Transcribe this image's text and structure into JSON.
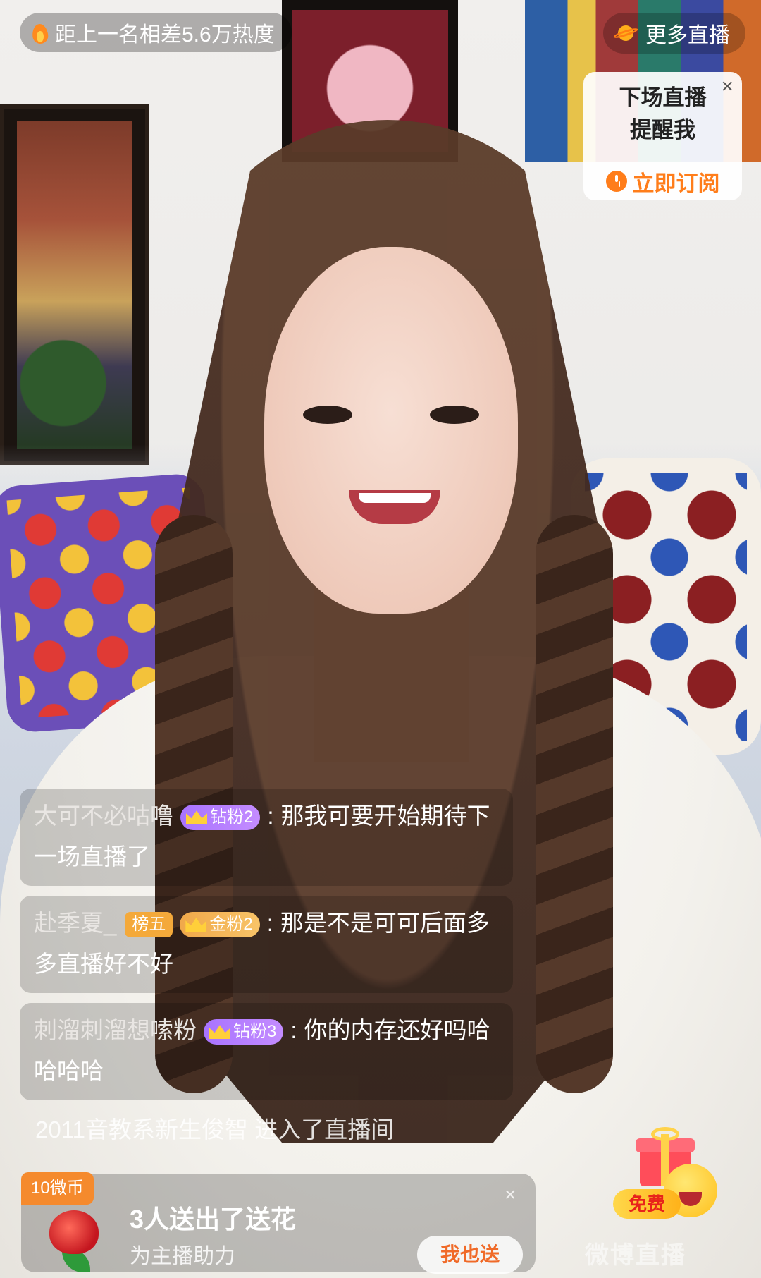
{
  "top": {
    "heat_text": "距上一名相差5.6万热度",
    "more_live_label": "更多直播"
  },
  "remind_card": {
    "line1": "下场直播",
    "line2": "提醒我",
    "close_glyph": "×",
    "subscribe_label": "立即订阅"
  },
  "chat": [
    {
      "user": "大可不必咕噜",
      "rank_badge": "",
      "fan_badge": "钻粉2",
      "fan_badge_type": "fan",
      "text": "那我可要开始期待下一场直播了"
    },
    {
      "user": "赴季夏_",
      "rank_badge": "榜五",
      "fan_badge": "金粉2",
      "fan_badge_type": "gold",
      "text": "那是不是可可后面多多直播好不好"
    },
    {
      "user": "刺溜刺溜想嗦粉",
      "rank_badge": "",
      "fan_badge": "钻粉3",
      "fan_badge_type": "fan",
      "text": "你的内存还好吗哈哈哈哈"
    }
  ],
  "enter_message": "2011音教系新生俊智 进入了直播间",
  "gift": {
    "coin_tag": "10微币",
    "title": "3人送出了送花",
    "subtitle": "为主播助力",
    "send_button": "我也送",
    "close_glyph": "×"
  },
  "free_gift_label": "免费",
  "watermark": "微博直播",
  "colors": {
    "accent_orange": "#ff7d1a",
    "fan_badge_purple": "#a873ff",
    "gold_badge": "#f0a84a"
  }
}
